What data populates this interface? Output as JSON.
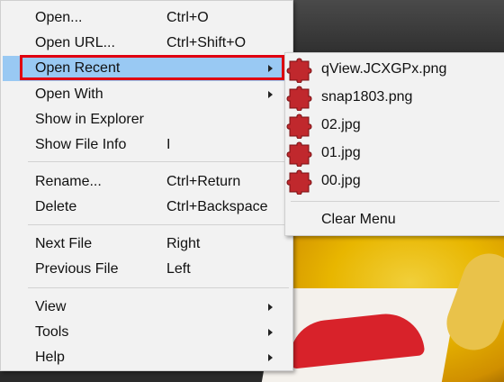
{
  "main_menu": {
    "items": [
      {
        "label": "Open...",
        "shortcut": "Ctrl+O"
      },
      {
        "label": "Open URL...",
        "shortcut": "Ctrl+Shift+O"
      },
      {
        "label": "Open Recent",
        "shortcut": ""
      },
      {
        "label": "Open With",
        "shortcut": ""
      },
      {
        "label": "Show in Explorer",
        "shortcut": ""
      },
      {
        "label": "Show File Info",
        "shortcut": "I"
      },
      {
        "label": "Rename...",
        "shortcut": "Ctrl+Return"
      },
      {
        "label": "Delete",
        "shortcut": "Ctrl+Backspace"
      },
      {
        "label": "Next File",
        "shortcut": "Right"
      },
      {
        "label": "Previous File",
        "shortcut": "Left"
      },
      {
        "label": "View",
        "shortcut": ""
      },
      {
        "label": "Tools",
        "shortcut": ""
      },
      {
        "label": "Help",
        "shortcut": ""
      }
    ]
  },
  "recent_menu": {
    "files": [
      "qView.JCXGPx.png",
      "snap1803.png",
      "02.jpg",
      "01.jpg",
      "00.jpg"
    ],
    "clear_label": "Clear Menu",
    "icon": "red-puzzle-file-icon"
  },
  "colors": {
    "highlight": "#99c9f3",
    "annotation": "#e00010",
    "file_icon": "#c0282d"
  }
}
